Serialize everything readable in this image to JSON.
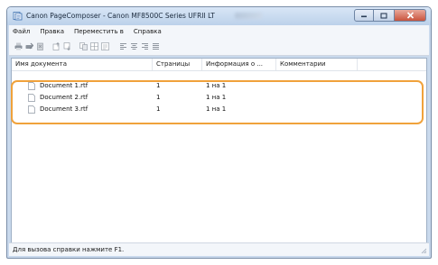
{
  "window": {
    "title": "Canon PageComposer - Canon MF8500C Series UFRII LT"
  },
  "menu": {
    "items": [
      "Файл",
      "Правка",
      "Переместить в",
      "Справка"
    ]
  },
  "toolbar": {
    "icons": [
      "print-icon",
      "print-settings-icon",
      "delete-icon",
      "move-up-icon",
      "move-down-icon",
      "combine-icon",
      "split-icon",
      "preview-icon",
      "align-left-icon",
      "align-center-icon",
      "align-right-icon",
      "align-justify-icon"
    ]
  },
  "table": {
    "columns": [
      "Имя документа",
      "Страницы",
      "Информация о ...",
      "Комментарии"
    ],
    "rows": [
      {
        "name": "Document 1.rtf",
        "pages": "1",
        "info": "1 на 1",
        "comment": ""
      },
      {
        "name": "Document 2.rtf",
        "pages": "1",
        "info": "1 на 1",
        "comment": ""
      },
      {
        "name": "Document 3.rtf",
        "pages": "1",
        "info": "1 на 1",
        "comment": ""
      }
    ]
  },
  "status": {
    "text": "Для вызова справки нажмите F1."
  },
  "colors": {
    "highlight": "#f0a23b",
    "close_button": "#c9533d",
    "title_bar": "#c9d9ec"
  }
}
